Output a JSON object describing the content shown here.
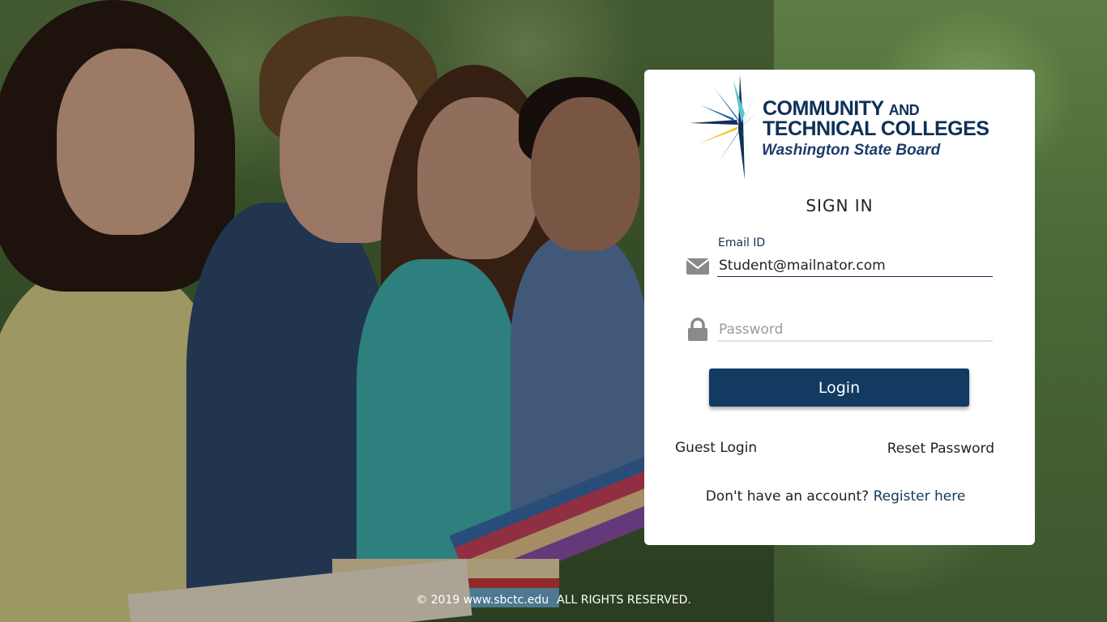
{
  "brand": {
    "line1": "COMMUNITY",
    "line1_suffix": "AND",
    "line2": "TECHNICAL COLLEGES",
    "line3": "Washington State Board",
    "colors": {
      "navy": "#0f3057",
      "teal": "#5bc6c8",
      "yellow": "#f3c21b",
      "blue": "#1e5fa8"
    }
  },
  "signin": {
    "title": "SIGN IN",
    "email": {
      "label": "Email ID",
      "value": "Student@mailnator.com",
      "icon": "envelope-icon"
    },
    "password": {
      "placeholder": "Password",
      "value": "",
      "icon": "lock-icon"
    },
    "login_label": "Login",
    "guest_login": "Guest Login",
    "reset_password": "Reset Password",
    "register_prompt": "Don't have an account?",
    "register_link": "Register here"
  },
  "footer": {
    "copyright": "© 2019 www.sbctc.edu",
    "rights": "ALL RIGHTS RESERVED."
  },
  "colors": {
    "primary_button": "#133a61",
    "card_bg": "#ffffff"
  }
}
